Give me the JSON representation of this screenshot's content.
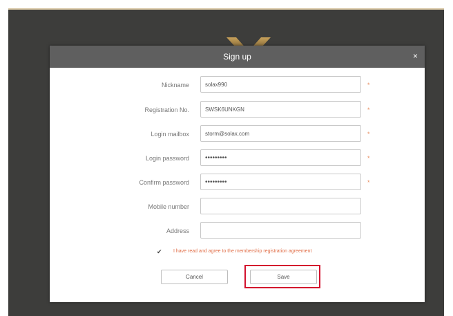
{
  "dialog": {
    "title": "Sign up",
    "close_glyph": "×"
  },
  "form": {
    "required_mark": "*",
    "fields": [
      {
        "label": "Nickname",
        "value": "solax990",
        "required": true
      },
      {
        "label": "Registration No.",
        "value": "SWSK6UNKGN",
        "required": true
      },
      {
        "label": "Login mailbox",
        "value": "storm@solax.com",
        "required": true
      },
      {
        "label": "Login password",
        "value": "•••••••••",
        "required": true
      },
      {
        "label": "Confirm password",
        "value": "•••••••••",
        "required": true
      },
      {
        "label": "Mobile number",
        "value": "",
        "required": false
      },
      {
        "label": "Address",
        "value": "",
        "required": false
      }
    ],
    "agreement": {
      "checked": true,
      "check_glyph": "✔",
      "text": "I have read and agree to the membership registration agreement"
    }
  },
  "buttons": {
    "cancel": "Cancel",
    "save": "Save"
  },
  "colors": {
    "backdrop": "#3d3d3b",
    "titlebar": "#5f5f5f",
    "required": "#e88b5c",
    "agreement_text": "#e06c45",
    "highlight": "#d3102d"
  },
  "icons": {
    "logo": "brand-logo-icon",
    "close": "close-icon",
    "checkbox": "checkbox-checked-icon"
  }
}
